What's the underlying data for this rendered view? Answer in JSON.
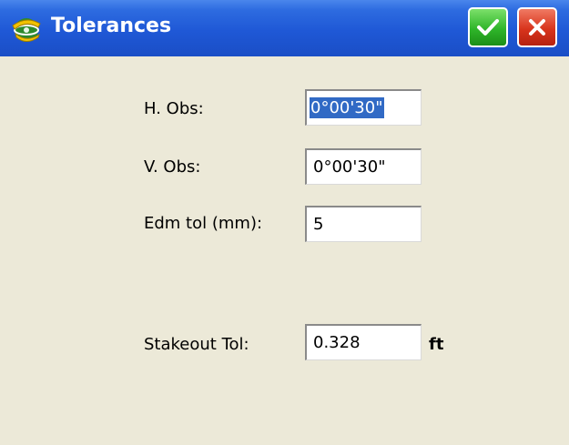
{
  "window": {
    "title": "Tolerances"
  },
  "toolbar": {
    "ok_icon": "checkmark-icon",
    "cancel_icon": "close-icon",
    "ok_color": "#2fb52a",
    "cancel_color": "#d8341c"
  },
  "colors": {
    "titlebar": "#1f58d6",
    "background": "#ece9d8",
    "selection": "#316ac5"
  },
  "form": {
    "h_obs": {
      "label": "H. Obs:",
      "value": "0°00'30\"",
      "selected": true
    },
    "v_obs": {
      "label": "V. Obs:",
      "value": "0°00'30\""
    },
    "edm_tol": {
      "label": "Edm tol (mm):",
      "value": "5"
    },
    "stakeout_tol": {
      "label": "Stakeout Tol:",
      "value": "0.328",
      "unit": "ft"
    }
  }
}
